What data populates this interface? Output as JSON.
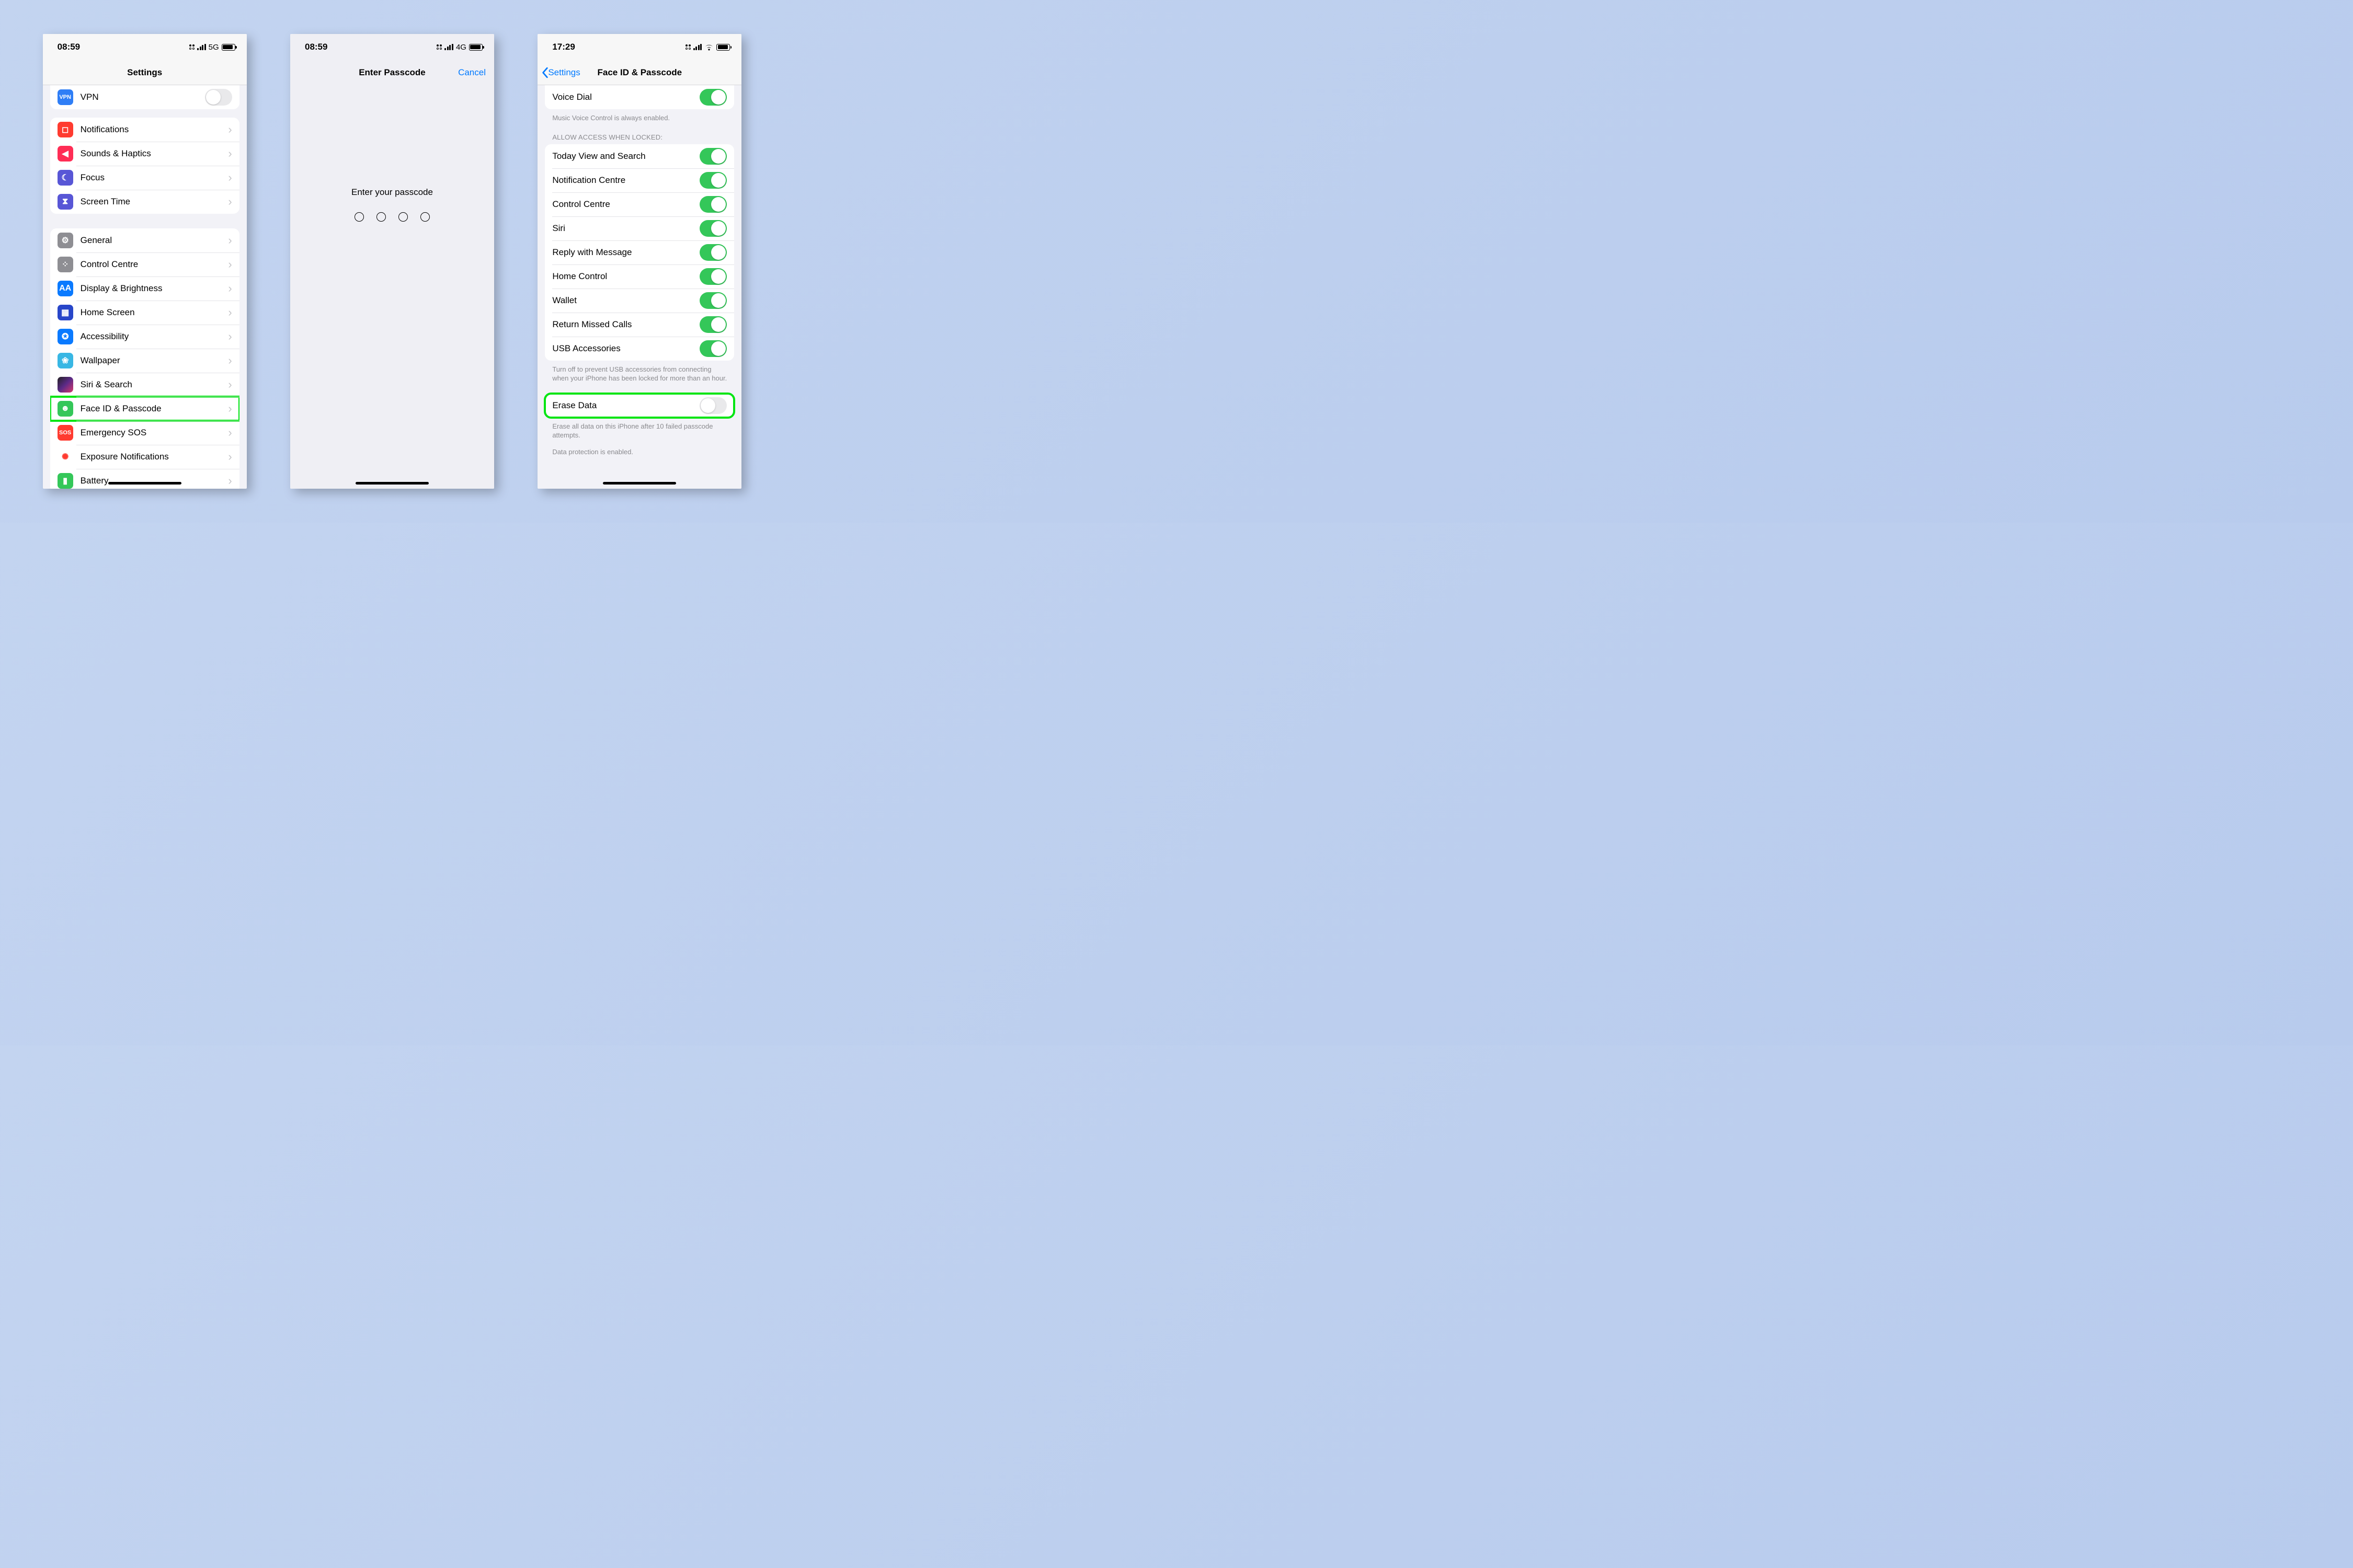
{
  "phone1": {
    "time": "08:59",
    "net": "5G",
    "nav_title": "Settings",
    "vpn_row": {
      "label": "VPN"
    },
    "group_notifs": [
      {
        "id": "notifications",
        "label": "Notifications",
        "iconClass": "c-notif",
        "glyph": "◻"
      },
      {
        "id": "sounds",
        "label": "Sounds & Haptics",
        "iconClass": "c-sound",
        "glyph": "◀"
      },
      {
        "id": "focus",
        "label": "Focus",
        "iconClass": "c-focus",
        "glyph": "☾"
      },
      {
        "id": "screentime",
        "label": "Screen Time",
        "iconClass": "c-screentime",
        "glyph": "⧗"
      }
    ],
    "group_general": [
      {
        "id": "general",
        "label": "General",
        "iconClass": "c-general",
        "glyph": "⚙"
      },
      {
        "id": "control",
        "label": "Control Centre",
        "iconClass": "c-control",
        "glyph": "⁘"
      },
      {
        "id": "display",
        "label": "Display & Brightness",
        "iconClass": "c-display",
        "glyph": "AA"
      },
      {
        "id": "home",
        "label": "Home Screen",
        "iconClass": "c-home",
        "glyph": "▦"
      },
      {
        "id": "access",
        "label": "Accessibility",
        "iconClass": "c-access",
        "glyph": "✪"
      },
      {
        "id": "wall",
        "label": "Wallpaper",
        "iconClass": "c-wall",
        "glyph": "❀"
      },
      {
        "id": "siri",
        "label": "Siri & Search",
        "iconClass": "c-siri",
        "glyph": ""
      },
      {
        "id": "faceid",
        "label": "Face ID & Passcode",
        "iconClass": "c-face",
        "glyph": "☻",
        "highlight": true
      },
      {
        "id": "sos",
        "label": "Emergency SOS",
        "iconClass": "c-sos",
        "glyph": "SOS"
      },
      {
        "id": "exposure",
        "label": "Exposure Notifications",
        "iconClass": "c-exp",
        "glyph": "✺"
      },
      {
        "id": "battery",
        "label": "Battery",
        "iconClass": "c-bat",
        "glyph": "▮"
      }
    ]
  },
  "phone2": {
    "time": "08:59",
    "net": "4G",
    "nav_title": "Enter Passcode",
    "cancel": "Cancel",
    "prompt": "Enter your passcode",
    "digits": 4
  },
  "phone3": {
    "time": "17:29",
    "back_label": "Settings",
    "nav_title": "Face ID & Passcode",
    "voice_dial": {
      "label": "Voice Dial",
      "on": true
    },
    "voice_footer": "Music Voice Control is always enabled.",
    "allow_header": "ALLOW ACCESS WHEN LOCKED:",
    "allow_rows": [
      {
        "id": "today",
        "label": "Today View and Search",
        "on": true
      },
      {
        "id": "notifc",
        "label": "Notification Centre",
        "on": true
      },
      {
        "id": "ccentre",
        "label": "Control Centre",
        "on": true
      },
      {
        "id": "siri",
        "label": "Siri",
        "on": true
      },
      {
        "id": "reply",
        "label": "Reply with Message",
        "on": true
      },
      {
        "id": "homec",
        "label": "Home Control",
        "on": true
      },
      {
        "id": "wallet",
        "label": "Wallet",
        "on": true
      },
      {
        "id": "missed",
        "label": "Return Missed Calls",
        "on": true
      },
      {
        "id": "usb",
        "label": "USB Accessories",
        "on": true
      }
    ],
    "usb_footer": "Turn off to prevent USB accessories from connecting when your iPhone has been locked for more than an hour.",
    "erase": {
      "label": "Erase Data",
      "on": false,
      "highlight": true
    },
    "erase_footer": "Erase all data on this iPhone after 10 failed passcode attempts.",
    "protection_footer": "Data protection is enabled."
  }
}
